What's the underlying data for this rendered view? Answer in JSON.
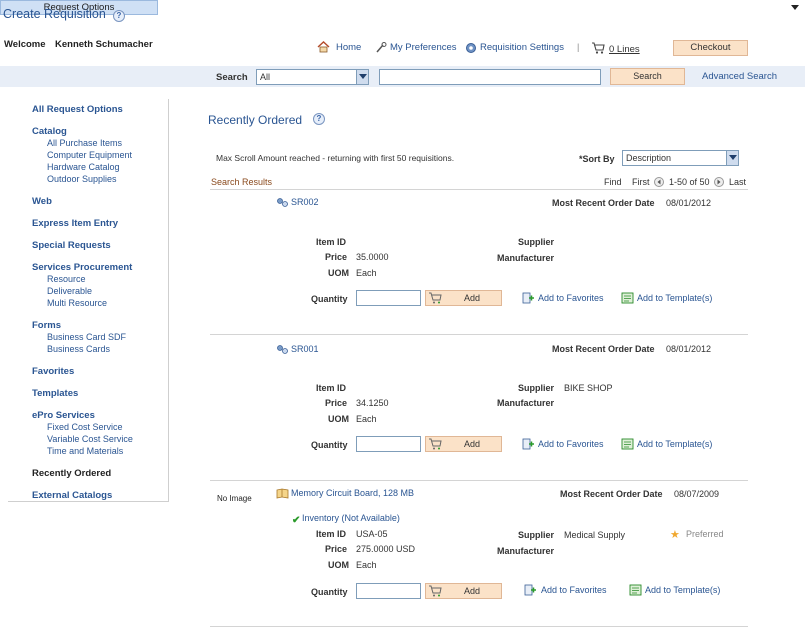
{
  "header": {
    "title": "Create Requisition",
    "welcome_label": "Welcome",
    "user_name": "Kenneth Schumacher",
    "nav": {
      "home": "Home",
      "preferences": "My Preferences",
      "req_settings": "Requisition Settings",
      "separator": "|",
      "cart": "0 Lines"
    },
    "checkout": "Checkout"
  },
  "search": {
    "request_options": "Request Options",
    "label": "Search",
    "category": "All",
    "query": "",
    "button": "Search",
    "advanced": "Advanced Search"
  },
  "sidebar": {
    "sections": [
      {
        "label": "All Request Options",
        "items": []
      },
      {
        "label": "Catalog",
        "items": [
          "All Purchase Items",
          "Computer Equipment",
          "Hardware Catalog",
          "Outdoor Supplies"
        ]
      },
      {
        "label": "Web",
        "items": []
      },
      {
        "label": "Express Item Entry",
        "items": []
      },
      {
        "label": "Special Requests",
        "items": []
      },
      {
        "label": "Services Procurement",
        "items": [
          "Resource",
          "Deliverable",
          "Multi Resource"
        ]
      },
      {
        "label": "Forms",
        "items": [
          "Business Card SDF",
          "Business Cards"
        ]
      },
      {
        "label": "Favorites",
        "items": []
      },
      {
        "label": "Templates",
        "items": []
      },
      {
        "label": "ePro Services",
        "items": [
          "Fixed Cost Service",
          "Variable Cost Service",
          "Time and Materials"
        ]
      },
      {
        "label": "Recently Ordered",
        "items": []
      },
      {
        "label": "External Catalogs",
        "items": []
      }
    ]
  },
  "main": {
    "title": "Recently Ordered",
    "notice": "Max Scroll Amount reached - returning with first 50 requisitions.",
    "sort_label": "*Sort By",
    "sort_value": "Description",
    "results_label": "Search Results",
    "pager": {
      "find": "Find",
      "first": "First",
      "range": "1-50 of 50",
      "last": "Last"
    },
    "labels": {
      "item_id": "Item ID",
      "price": "Price",
      "uom": "UOM",
      "quantity": "Quantity",
      "supplier": "Supplier",
      "manufacturer": "Manufacturer",
      "recent_date": "Most Recent Order Date",
      "add": "Add",
      "add_fav": "Add to Favorites",
      "add_tmpl": "Add to Template(s)"
    },
    "items": [
      {
        "name": "SR002",
        "item_id": "",
        "price": "35.0000",
        "uom": "Each",
        "supplier": "",
        "manufacturer": "",
        "date": "08/01/2012"
      },
      {
        "name": "SR001",
        "item_id": "",
        "price": "34.1250",
        "uom": "Each",
        "supplier": "BIKE SHOP",
        "manufacturer": "",
        "date": "08/01/2012"
      },
      {
        "name": "Memory Circuit Board, 128 MB",
        "no_image": "No Image",
        "inventory": "Inventory (Not Available)",
        "item_id": "USA-05",
        "price": "275.0000 USD",
        "uom": "Each",
        "supplier": "Medical Supply",
        "manufacturer": "",
        "preferred": "Preferred",
        "date": "08/07/2009"
      }
    ]
  },
  "colors": {
    "link": "#2a5592",
    "button_bg": "#fbe2c8",
    "bar_bg": "#cfe0f5"
  }
}
